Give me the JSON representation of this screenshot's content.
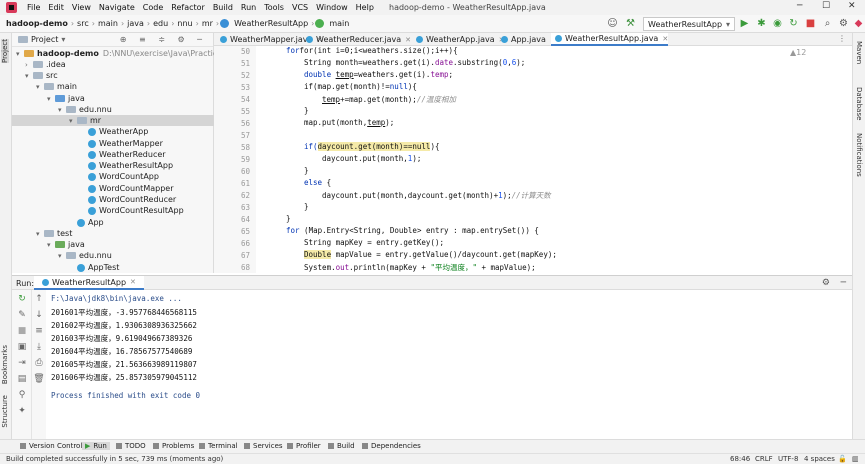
{
  "menu": {
    "items": [
      "File",
      "Edit",
      "View",
      "Navigate",
      "Code",
      "Refactor",
      "Build",
      "Run",
      "Tools",
      "VCS",
      "Window",
      "Help"
    ],
    "window_title": "hadoop-demo - WeatherResultApp.java"
  },
  "nav": {
    "crumbs": [
      "hadoop-demo",
      "src",
      "main",
      "java",
      "edu",
      "nnu",
      "mr",
      "WeatherResultApp",
      "main"
    ],
    "run_config": "WeatherResultApp"
  },
  "left_strip": {
    "project": "Project",
    "bookmarks": "Bookmarks",
    "structure": "Structure"
  },
  "right_strip": {
    "maven": "Maven",
    "database": "Database",
    "notifications": "Notifications"
  },
  "project": {
    "header": "Project",
    "root": "hadoop-demo",
    "root_path": "D:\\NNU\\exercise\\Java\\Practice\\hadoo",
    "nodes": {
      "idea": ".idea",
      "src": "src",
      "main": "main",
      "java": "java",
      "edunnu": "edu.nnu",
      "mr": "mr",
      "c1": "WeatherApp",
      "c2": "WeatherMapper",
      "c3": "WeatherReducer",
      "c4": "WeatherResultApp",
      "c5": "WordCountApp",
      "c6": "WordCountMapper",
      "c7": "WordCountReducer",
      "c8": "WordCountResultApp",
      "app": "App",
      "test": "test",
      "tjava": "java",
      "tedunnu": "edu.nnu",
      "apptest": "AppTest"
    }
  },
  "editor": {
    "tabs": [
      "WeatherMapper.java",
      "WeatherReducer.java",
      "WeatherApp.java",
      "App.java",
      "WeatherResultApp.java"
    ],
    "warnings": "▲12",
    "line_numbers": [
      "50",
      "51",
      "52",
      "53",
      "54",
      "55",
      "56",
      "57",
      "58",
      "59",
      "60",
      "61",
      "62",
      "63",
      "64",
      "65",
      "66",
      "67",
      "68"
    ],
    "lines": {
      "l50": "for(int i=0;i<weathers.size();i++){",
      "l51a": "String month=weathers.get(i).",
      "l51b": "date",
      "l51c": ".substring(",
      "l51d": "0",
      "l51e": ",",
      "l51f": "6",
      "l51g": ");",
      "l52a": "double ",
      "l52b": "temp",
      "l52c": "=weathers.get(i).",
      "l52d": "temp",
      "l52e": ";",
      "l53a": "if(map.get(month)!=",
      "l53b": "null",
      "l53c": "){",
      "l54a": "temp",
      "l54b": "+=map.get(month);",
      "l54c": "//温度相加",
      "l55": "}",
      "l56a": "map.put(month,",
      "l56b": "temp",
      "l56c": ");",
      "l57": "",
      "l58a": "if(",
      "l58b": "daycount.get(month)==null",
      "l58c": "){",
      "l59a": "daycount.put(month,",
      "l59b": "1",
      "l59c": ");",
      "l60": "}",
      "l61a": "else",
      "l61b": " {",
      "l62a": "daycount.put(month,daycount.get(month)+",
      "l62b": "1",
      "l62c": ");",
      "l62d": "//计算天数",
      "l63": "}",
      "l64": "}",
      "l65a": "for",
      "l65b": " (Map.Entry<String, Double> entry : map.entrySet()) {",
      "l66": "String mapKey = entry.getKey();",
      "l67a": "Double",
      "l67b": " mapValue = entry.getValue()/daycount.get(mapKey);",
      "l68a": "System.",
      "l68b": "out",
      "l68c": ".println(mapKey + ",
      "l68d": "\"平均温度，\"",
      "l68e": " + mapValue);"
    }
  },
  "run": {
    "label": "Run:",
    "tab": "WeatherResultApp",
    "output": [
      "F:\\Java\\jdk8\\bin\\java.exe ...",
      "201601平均温度，-3.957768446568115",
      "201602平均温度，1.9306308936325662",
      "201603平均温度，9.619049667389326",
      "201604平均温度，16.78567577540689",
      "201605平均温度，21.563663989119807",
      "201606平均温度，25.857305979045112"
    ],
    "finished": "Process finished with exit code 0"
  },
  "bottom_tabs": [
    "Version Control",
    "Run",
    "TODO",
    "Problems",
    "Terminal",
    "Services",
    "Profiler",
    "Build",
    "Dependencies"
  ],
  "status": {
    "message": "Build completed successfully in 5 sec, 739 ms (moments ago)",
    "position": "68:46",
    "line_sep": "CRLF",
    "encoding": "UTF-8",
    "indent": "4 spaces"
  }
}
